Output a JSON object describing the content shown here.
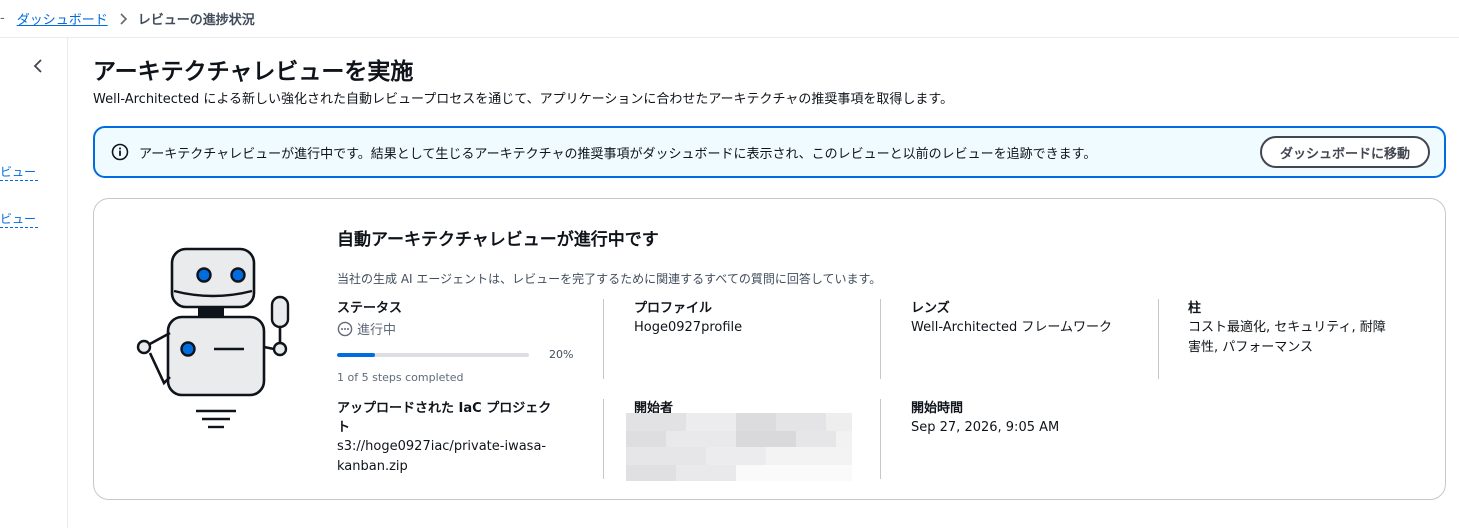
{
  "breadcrumb": {
    "home": "ダッシュボード",
    "current": "レビューの進捗状況"
  },
  "side": {
    "link1": "ビュー",
    "link2": "ビュー"
  },
  "page": {
    "title": "アーキテクチャレビューを実施",
    "description": "Well-Architected による新しい強化された自動レビュープロセスを通じて、アプリケーションに合わせたアーキテクチャの推奨事項を取得します。"
  },
  "alert": {
    "text": "アーキテクチャレビューが進行中です。結果として生じるアーキテクチャの推奨事項がダッシュボードに表示され、このレビューと以前のレビューを追跡できます。",
    "button": "ダッシュボードに移動"
  },
  "card": {
    "title": "自動アーキテクチャレビューが進行中です",
    "description": "当社の生成 AI エージェントは、レビューを完了するために関連するすべての質問に回答しています。",
    "status": {
      "label": "ステータス",
      "value": "進行中",
      "progress": 0.2,
      "percent_text": "20%",
      "steps_text": "1 of 5 steps completed"
    },
    "profile": {
      "label": "プロファイル",
      "value": "Hoge0927profile"
    },
    "lens": {
      "label": "レンズ",
      "value": "Well-Architected フレームワーク"
    },
    "pillars": {
      "label": "柱",
      "value_line1": "コスト最適化, セキュリティ, 耐障",
      "value_line2": "害性, パフォーマンス"
    },
    "iac": {
      "label_line1": "アップロードされた IaC プロジェク",
      "label_line2": "ト",
      "value_line1": "s3://hoge0927iac/private-iwasa-",
      "value_line2": "kanban.zip"
    },
    "starter": {
      "label": "開始者"
    },
    "start_time": {
      "label": "開始時間",
      "value": "Sep 27, 2026, 9:05 AM"
    }
  },
  "colors": {
    "accent": "#006ce0",
    "alert_bg": "#f0fbff",
    "border": "#c6c6cd"
  }
}
